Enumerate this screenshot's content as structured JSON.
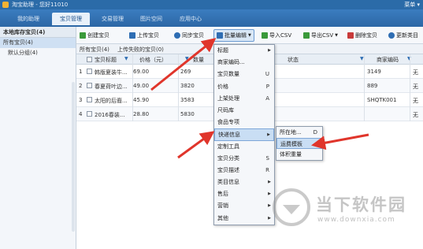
{
  "titlebar": {
    "title": "淘宝助理 - 您好11010",
    "menu": "菜单 ▾"
  },
  "nav": {
    "tabs": [
      {
        "label": "我的助理",
        "active": false
      },
      {
        "label": "宝贝管理",
        "active": true
      },
      {
        "label": "交易管理",
        "active": false
      },
      {
        "label": "图片空间",
        "active": false
      },
      {
        "label": "应用中心",
        "active": false
      }
    ]
  },
  "sidebar": {
    "header": "本地库存宝贝(4)",
    "items": [
      {
        "label": "所有宝贝(4)",
        "selected": true
      },
      {
        "label": "默认分组(4)",
        "selected": false
      }
    ]
  },
  "toolbar": {
    "buttons": [
      {
        "label": "创建宝贝",
        "icon": "create-icon",
        "color": "#3a9a3a"
      },
      {
        "label": "上传宝贝",
        "icon": "upload-icon",
        "color": "#2e6db3"
      },
      {
        "label": "同步宝贝",
        "icon": "sync-icon",
        "color": "#2e6db3"
      },
      {
        "label": "批量编辑",
        "icon": "batch-edit-icon",
        "color": "#2e6db3"
      },
      {
        "label": "导入CSV",
        "icon": "import-icon",
        "color": "#3a9a3a"
      },
      {
        "label": "导出CSV",
        "icon": "export-icon",
        "color": "#3a9a3a"
      },
      {
        "label": "删除宝贝",
        "icon": "delete-icon",
        "color": "#c83a3a"
      },
      {
        "label": "更新类目",
        "icon": "update-icon",
        "color": "#2e6db3"
      }
    ]
  },
  "tabs": {
    "all": "所有宝贝(4)",
    "failed": "上传失败的宝贝(0)"
  },
  "table": {
    "headers": [
      "宝贝标题",
      "价格（元）",
      "数量",
      "状态",
      "商家编码"
    ],
    "rows": [
      {
        "no": "1",
        "title": "韩版夏装牛...",
        "price": "69.00",
        "qty": "269",
        "code": "3149",
        "extra": "无"
      },
      {
        "no": "2",
        "title": "春夏荷叶边...",
        "price": "49.00",
        "qty": "3820",
        "code": "889",
        "extra": "无"
      },
      {
        "no": "3",
        "title": "太阳的后裔...",
        "price": "45.90",
        "qty": "3583",
        "code": "SHQTK001",
        "extra": "无"
      },
      {
        "no": "4",
        "title": "2016春装...",
        "price": "28.80",
        "qty": "5830",
        "code": "",
        "extra": "无"
      }
    ]
  },
  "menu": {
    "items": [
      {
        "label": "标题",
        "key": "",
        "arrow": true,
        "highlight": false
      },
      {
        "label": "商家编码...",
        "key": "",
        "arrow": false,
        "highlight": false
      },
      {
        "label": "宝贝数量",
        "key": "U",
        "arrow": false,
        "highlight": false
      },
      {
        "label": "价格",
        "key": "P",
        "arrow": false,
        "highlight": false
      },
      {
        "label": "上架处理",
        "key": "A",
        "arrow": false,
        "highlight": false
      },
      {
        "label": "尺码库",
        "key": "",
        "arrow": false,
        "highlight": false
      },
      {
        "label": "食品专项",
        "key": "",
        "arrow": false,
        "highlight": false
      },
      {
        "label": "快递信息",
        "key": "",
        "arrow": true,
        "highlight": true
      },
      {
        "label": "定制工具",
        "key": "",
        "arrow": false,
        "highlight": false
      },
      {
        "label": "宝贝分类",
        "key": "S",
        "arrow": false,
        "highlight": false
      },
      {
        "label": "宝贝描述",
        "key": "R",
        "arrow": false,
        "highlight": false
      },
      {
        "label": "类目信息",
        "key": "",
        "arrow": true,
        "highlight": false
      },
      {
        "label": "售后",
        "key": "",
        "arrow": true,
        "highlight": false
      },
      {
        "label": "营销",
        "key": "",
        "arrow": true,
        "highlight": false
      },
      {
        "label": "其他",
        "key": "",
        "arrow": true,
        "highlight": false
      }
    ]
  },
  "submenu": {
    "items": [
      {
        "label": "所在地...",
        "key": "D",
        "highlight": false
      },
      {
        "label": "运费模板",
        "key": "",
        "highlight": true
      },
      {
        "label": "体积重量",
        "key": "",
        "highlight": false
      }
    ]
  },
  "watermark": {
    "name": "当下软件园",
    "url": "www.downxia.com"
  },
  "colors": {
    "nav_bg": "#2c67a5",
    "accent": "#2e6db3",
    "arrow_red": "#e0352b"
  }
}
